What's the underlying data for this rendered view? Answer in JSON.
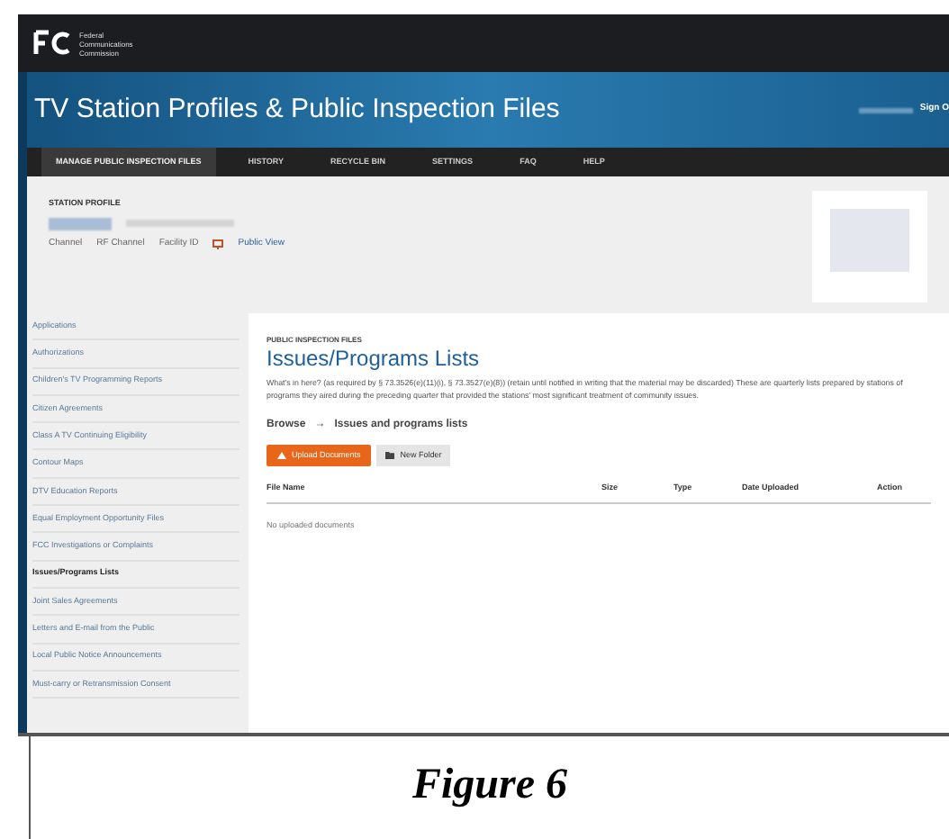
{
  "header": {
    "agency": [
      "Federal",
      "Communications",
      "Commission"
    ]
  },
  "banner": {
    "title": "TV Station Profiles & Public Inspection Files",
    "sign_out": "Sign O"
  },
  "nav": [
    {
      "label": "MANAGE PUBLIC INSPECTION FILES",
      "selected": true
    },
    {
      "label": "HISTORY",
      "selected": false
    },
    {
      "label": "RECYCLE BIN",
      "selected": false
    },
    {
      "label": "SETTINGS",
      "selected": false
    },
    {
      "label": "FAQ",
      "selected": false
    },
    {
      "label": "HELP",
      "selected": false
    }
  ],
  "profile": {
    "heading": "STATION PROFILE",
    "channel": "Channel",
    "rf_channel": "RF Channel",
    "facility": "Facility ID",
    "public_view": "Public View"
  },
  "sidebar": [
    {
      "label": "Applications",
      "selected": false
    },
    {
      "label": "Authorizations",
      "selected": false
    },
    {
      "label": "Children's TV Programming Reports",
      "selected": false
    },
    {
      "label": "Citizen Agreements",
      "selected": false
    },
    {
      "label": "Class A TV Continuing Eligibility",
      "selected": false
    },
    {
      "label": "Contour Maps",
      "selected": false
    },
    {
      "label": "DTV Education Reports",
      "selected": false
    },
    {
      "label": "Equal Employment Opportunity Files",
      "selected": false
    },
    {
      "label": "FCC Investigations or Complaints",
      "selected": false
    },
    {
      "label": "Issues/Programs Lists",
      "selected": true
    },
    {
      "label": "Joint Sales Agreements",
      "selected": false
    },
    {
      "label": "Letters and E-mail from the Public",
      "selected": false
    },
    {
      "label": "Local Public Notice Announcements",
      "selected": false
    },
    {
      "label": "Must-carry or Retransmission Consent",
      "selected": false
    }
  ],
  "main": {
    "eyebrow": "PUBLIC INSPECTION FILES",
    "title": "Issues/Programs Lists",
    "description": "What's in here? (as required by § 73.3526(e)(11)(i), § 73.3527(e)(8)) (retain until notified in writing that the material may be discarded) These are quarterly lists prepared by stations of programs they aired during the preceding quarter that provided the stations' most significant treatment of community issues.",
    "breadcrumb": [
      "Browse",
      "→",
      "Issues and programs lists"
    ],
    "upload": "Upload Documents",
    "new_folder": "New Folder",
    "columns": [
      "File Name",
      "Size",
      "Type",
      "Date Uploaded",
      "Action"
    ],
    "empty": "No uploaded documents"
  },
  "caption": "Figure 6"
}
